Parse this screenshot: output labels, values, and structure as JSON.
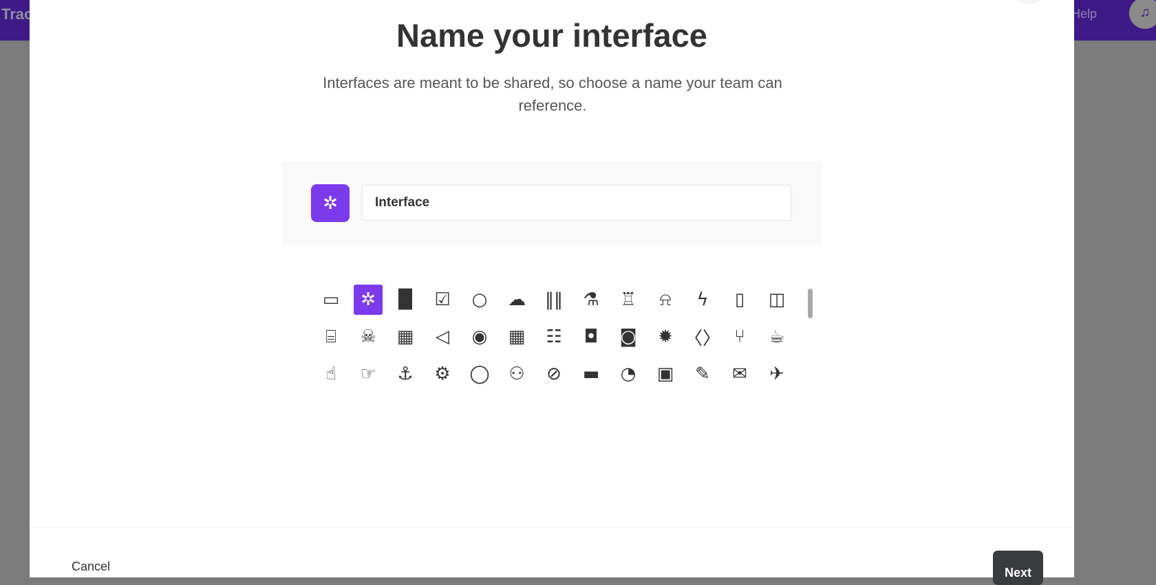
{
  "app": {
    "brand": "Trac",
    "help_label": "Help",
    "bell_icon": "bell-icon"
  },
  "modal": {
    "title": "Name your interface",
    "subtitle": "Interfaces are meant to be shared, so choose a name your team can reference.",
    "selected_icon": "asterisk",
    "name_value": "Interface",
    "accent": "#7c3aed",
    "icon_rows": [
      [
        "folder",
        "asterisk",
        "bar-chart",
        "checkbox",
        "circle",
        "cloud",
        "barcode",
        "flask",
        "beer",
        "bell",
        "bolt",
        "book",
        "columns"
      ],
      [
        "briefcase",
        "bug",
        "building",
        "bullhorn",
        "bullseye",
        "calculator",
        "calendar",
        "camera",
        "camera-filled",
        "certificate",
        "code",
        "code-fork",
        "coffee"
      ],
      [
        "hand-pointer",
        "hand-right",
        "anchor",
        "gears",
        "comment",
        "comments",
        "compass",
        "credit-card",
        "dashboard",
        "desktop",
        "pencil",
        "envelope",
        "plane"
      ],
      [
        "row4-a",
        "row4-b",
        "row4-c",
        "row4-d",
        "row4-e",
        "row4-f",
        "row4-g",
        "row4-h",
        "row4-i",
        "row4-j",
        "row4-k",
        "row4-l",
        "row4-m"
      ]
    ],
    "cancel_label": "Cancel",
    "next_label": "Next"
  }
}
